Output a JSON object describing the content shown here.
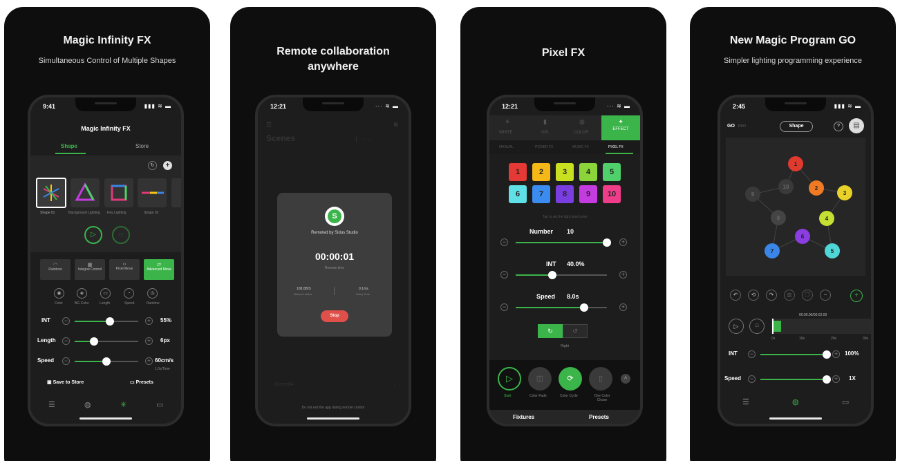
{
  "colors": {
    "accent": "#3bb44a",
    "card_bg": "#0e0e0e",
    "phone_bg": "#1d1d1d",
    "stop_red": "#e0504a"
  },
  "panel1": {
    "headline": "Magic Infinity FX",
    "subline": "Simultaneous Control of Multiple Shapes",
    "status_time": "9:41",
    "app_title": "Magic Infinity FX",
    "tabs": [
      "Shape",
      "Store"
    ],
    "shapes": [
      "Shape 01",
      "Background Lighting",
      "Key Lighting",
      "Shape 02"
    ],
    "modes": [
      "Rainbow",
      "Integral Control",
      "Pixel Move",
      "Advanced Move"
    ],
    "params": [
      "Color",
      "BG Color",
      "Length",
      "Speed",
      "Runtime"
    ],
    "sliders": [
      {
        "label": "INT",
        "value": "55%",
        "level": 0.55
      },
      {
        "label": "Length",
        "value": "6px",
        "level": 0.3
      },
      {
        "label": "Speed",
        "value": "60cm/s",
        "level": 0.5
      }
    ],
    "speed_sub": "1.0s/Time",
    "save_label": "Save to Store",
    "presets_label": "Presets",
    "bottom_icons": [
      "list-icon",
      "palette-icon",
      "atom-icon",
      "monitor-icon"
    ]
  },
  "panel2": {
    "headline_line1": "Remote collaboration",
    "headline_line2": "anywhere",
    "status_time": "12:21",
    "page_title": "Scenes",
    "remoted_by": "Remoted by Sidus Studio",
    "timer": "00:00:01",
    "timer_label": "Remote time",
    "network_value": "108.0B/S",
    "network_label": "Network status",
    "delay_value": "0.1ms",
    "delay_label": "Delay Time",
    "stop_label": "Stop",
    "scene_name": "Scene04",
    "footer_note": "Do not exit the app during remote control"
  },
  "panel3": {
    "headline": "Pixel FX",
    "status_time": "12:21",
    "top_tabs": [
      "WHITE",
      "GEL",
      "COLOR",
      "EFFECT"
    ],
    "sub_tabs": [
      "MANUAL",
      "PICKER FX",
      "MUSIC FX",
      "PIXEL FX"
    ],
    "pixels": [
      {
        "n": "1",
        "color": "#e53935"
      },
      {
        "n": "2",
        "color": "#f5b817"
      },
      {
        "n": "3",
        "color": "#c9e021"
      },
      {
        "n": "4",
        "color": "#8bd43a"
      },
      {
        "n": "5",
        "color": "#4fd06a"
      },
      {
        "n": "6",
        "color": "#5fe0e6"
      },
      {
        "n": "7",
        "color": "#3a8cf0"
      },
      {
        "n": "8",
        "color": "#7a3de0"
      },
      {
        "n": "9",
        "color": "#c43be0"
      },
      {
        "n": "10",
        "color": "#f03d8a"
      }
    ],
    "pixel_hint": "Tap to set the light pixel color",
    "number_label": "Number",
    "number_value": "10",
    "number_level": 1.0,
    "int_label": "INT",
    "int_value": "40.0%",
    "int_level": 0.4,
    "speed_label": "Speed",
    "speed_value": "8.0s",
    "speed_level": 0.75,
    "direction_label": "Right",
    "modes": [
      "Start",
      "Color Fade",
      "Color Cycle",
      "One Color Chase"
    ],
    "fixtures_label": "Fixtures",
    "presets_label": "Presets"
  },
  "panel4": {
    "headline": "New Magic Program GO",
    "subline": "Simpler lighting programming experience",
    "status_time": "2:45",
    "go_label": "GO",
    "go_sub": "PRO",
    "shape_label": "Shape",
    "help_label": "?",
    "nodes": [
      {
        "n": "1",
        "color": "#e03a2f"
      },
      {
        "n": "2",
        "color": "#f07a24"
      },
      {
        "n": "3",
        "color": "#e8d22a"
      },
      {
        "n": "4",
        "color": "#c5e032"
      },
      {
        "n": "5",
        "color": "#4fd6d6"
      },
      {
        "n": "6",
        "color": "#8a3de0"
      },
      {
        "n": "7",
        "color": "#3a86e8"
      },
      {
        "n": "8",
        "color": "#444444"
      },
      {
        "n": "9",
        "color": "#3a3a3a"
      },
      {
        "n": "10",
        "color": "#3a3a3a"
      }
    ],
    "timecode": "00:00.00/00:02.00",
    "timeline_ticks": [
      "0s",
      "10s",
      "20s",
      "30s"
    ],
    "int_label": "INT",
    "int_value": "100%",
    "int_level": 1.0,
    "speed_label": "Speed",
    "speed_value": "1X",
    "speed_level": 1.0
  }
}
